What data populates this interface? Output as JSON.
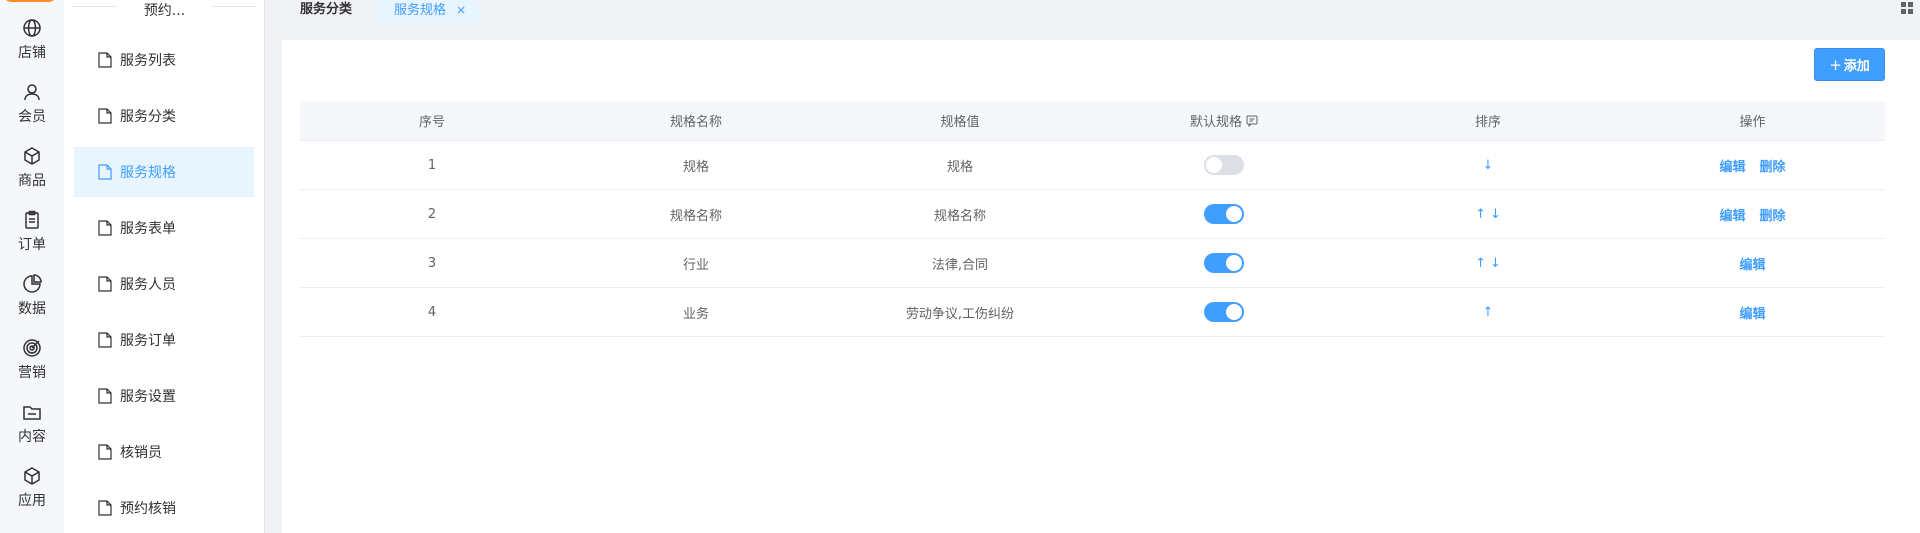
{
  "rail": {
    "items": [
      {
        "label": "店铺",
        "icon": "globe-icon"
      },
      {
        "label": "会员",
        "icon": "user-icon"
      },
      {
        "label": "商品",
        "icon": "box-icon"
      },
      {
        "label": "订单",
        "icon": "clipboard-icon"
      },
      {
        "label": "数据",
        "icon": "pie-chart-icon"
      },
      {
        "label": "营销",
        "icon": "target-icon"
      },
      {
        "label": "内容",
        "icon": "folder-icon"
      },
      {
        "label": "应用",
        "icon": "cube-icon"
      }
    ]
  },
  "submenu": {
    "header": "预约...",
    "items": [
      {
        "label": "服务列表"
      },
      {
        "label": "服务分类"
      },
      {
        "label": "服务规格",
        "active": true
      },
      {
        "label": "服务表单"
      },
      {
        "label": "服务人员"
      },
      {
        "label": "服务订单"
      },
      {
        "label": "服务设置"
      },
      {
        "label": "核销员"
      },
      {
        "label": "预约核销"
      }
    ]
  },
  "tabs": [
    {
      "label": "服务分类"
    },
    {
      "label": "服务规格",
      "close": "×"
    }
  ],
  "toolbar": {
    "add_plus": "+",
    "add_label": "添加"
  },
  "table": {
    "headers": [
      "序号",
      "规格名称",
      "规格值",
      "默认规格",
      "排序",
      "操作"
    ],
    "rows": [
      {
        "index": "1",
        "name": "规格",
        "value": "规格",
        "default_on": false,
        "up": false,
        "down": true,
        "ops": [
          "编辑",
          "删除"
        ]
      },
      {
        "index": "2",
        "name": "规格名称",
        "value": "规格名称",
        "default_on": true,
        "up": true,
        "down": true,
        "ops": [
          "编辑",
          "删除"
        ]
      },
      {
        "index": "3",
        "name": "行业",
        "value": "法律,合同",
        "default_on": true,
        "up": true,
        "down": true,
        "ops": [
          "编辑"
        ]
      },
      {
        "index": "4",
        "name": "业务",
        "value": "劳动争议,工伤纠纷",
        "default_on": true,
        "up": true,
        "down": false,
        "ops": [
          "编辑"
        ]
      }
    ],
    "arrow_up": "↑",
    "arrow_down": "↓"
  },
  "colors": {
    "accent": "#409eff",
    "logo": "#ff8a1f"
  }
}
